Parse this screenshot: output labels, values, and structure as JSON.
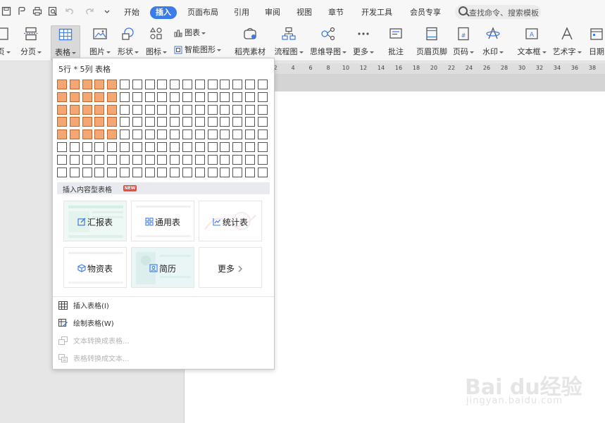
{
  "menu_tabs": [
    "开始",
    "插入",
    "页面布局",
    "引用",
    "审阅",
    "视图",
    "章节",
    "开发工具",
    "会员专享"
  ],
  "search_placeholder": "查找命令、搜索模板",
  "ribbon": {
    "page_partial": "页",
    "section_break": "分页",
    "table": "表格",
    "picture": "图片",
    "shape": "形状",
    "icon": "图标",
    "chart": "图表",
    "smart_art": "智能图形",
    "material": "稻壳素材",
    "flowchart": "流程图",
    "mindmap": "思维导图",
    "more": "更多",
    "comment": "批注",
    "header_footer": "页眉页脚",
    "page_number": "页码",
    "watermark": "水印",
    "textbox": "文本框",
    "wordart": "艺术字",
    "date": "日期"
  },
  "ruler_ticks": [
    "2",
    "4",
    "6",
    "8",
    "10",
    "12",
    "14",
    "16",
    "18",
    "20",
    "22",
    "24",
    "26",
    "28",
    "30",
    "32",
    "34",
    "36",
    "38"
  ],
  "dropdown": {
    "size_label": "5行 * 5列 表格",
    "selected_rows": 5,
    "selected_cols": 5,
    "grid_rows": 8,
    "grid_cols": 17,
    "section_title": "插入内容型表格",
    "new_badge": "NEW",
    "cards": {
      "report": "汇报表",
      "general": "通用表",
      "stats": "统计表",
      "materials": "物资表",
      "resume": "简历",
      "more": "更多"
    },
    "menu": {
      "insert_table": "插入表格(I)",
      "draw_table": "绘制表格(W)",
      "text_to_table": "文本转换成表格...",
      "table_to_text": "表格转换成文本..."
    }
  },
  "watermark": {
    "brand": "Bai du经验",
    "url": "jingyan.baidu.com"
  },
  "colors": {
    "accent": "#3b7bea",
    "cell_selected": "#f4a773",
    "new_badge": "#e74c3c"
  }
}
